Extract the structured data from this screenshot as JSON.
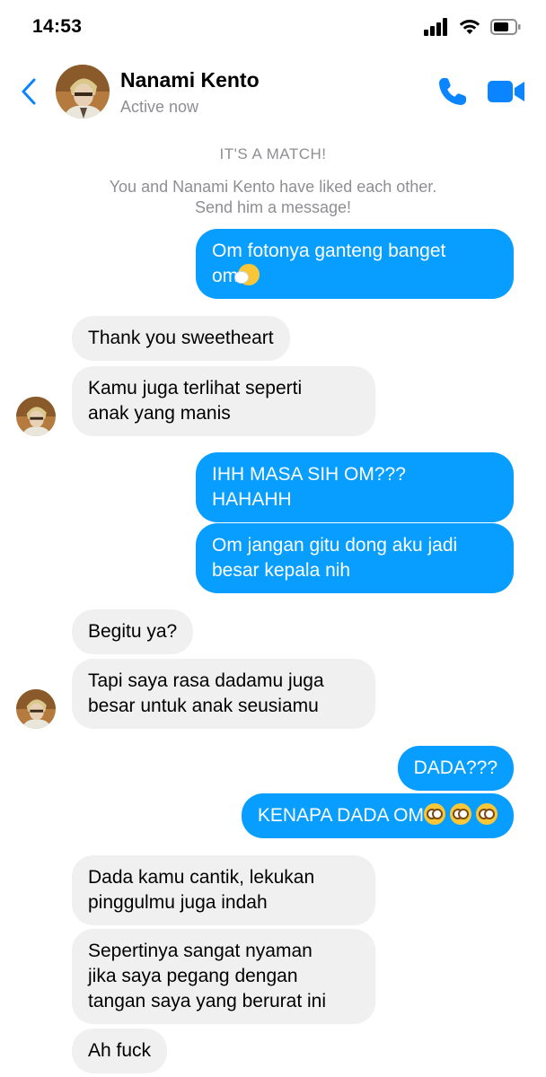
{
  "status_bar": {
    "time": "14:53"
  },
  "header": {
    "name": "Nanami Kento",
    "status": "Active now",
    "accent_color": "#0a84ff"
  },
  "match": {
    "title": "IT'S A MATCH!",
    "subtitle_line1": "You and Nanami Kento have liked each other.",
    "subtitle_line2": "Send him a message!"
  },
  "messages": [
    {
      "sender": "me",
      "lines": [
        "Om fotonya ganteng banget",
        "om"
      ],
      "emoji": "sneezing-face"
    },
    {
      "sender": "them",
      "lines": [
        "Thank you sweetheart"
      ]
    },
    {
      "sender": "them",
      "lines": [
        "Kamu juga terlihat seperti",
        "anak yang manis"
      ]
    },
    {
      "sender": "me",
      "lines": [
        "IHH MASA SIH OM???",
        "HAHAHH"
      ]
    },
    {
      "sender": "me",
      "lines": [
        "Om jangan gitu dong aku jadi",
        "besar kepala nih"
      ]
    },
    {
      "sender": "them",
      "lines": [
        "Begitu ya?"
      ]
    },
    {
      "sender": "them",
      "lines": [
        "Tapi saya rasa dadamu juga",
        "besar untuk anak seusiamu"
      ]
    },
    {
      "sender": "me",
      "lines": [
        "DADA???"
      ]
    },
    {
      "sender": "me",
      "lines": [
        "KENAPA DADA OM"
      ],
      "emoji": "flushed-face x3"
    },
    {
      "sender": "them",
      "lines": [
        "Dada kamu cantik, lekukan",
        "pinggulmu juga indah"
      ]
    },
    {
      "sender": "them",
      "lines": [
        "Sepertinya sangat nyaman",
        "jika saya pegang dengan",
        "tangan saya yang berurat ini"
      ]
    },
    {
      "sender": "them",
      "lines": [
        "Ah fuck"
      ]
    }
  ],
  "colors": {
    "sent_bubble": "#079eff",
    "received_bubble": "#f0f0f0",
    "muted_text": "#8e8e93"
  }
}
